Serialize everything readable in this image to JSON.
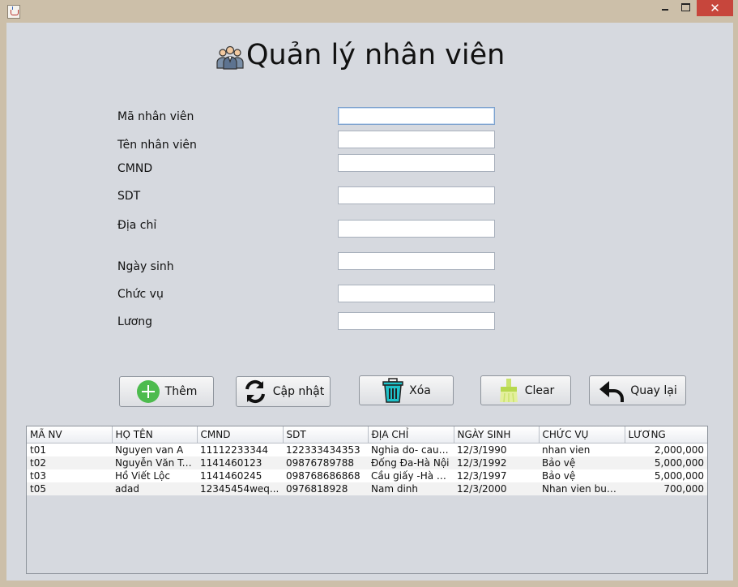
{
  "window": {
    "close_glyph": "✕"
  },
  "header": {
    "title": "Quản lý nhân viên",
    "icon": "people-group-icon"
  },
  "form": {
    "fields": [
      {
        "label": "Mã nhân viên",
        "value": ""
      },
      {
        "label": "Tên nhân viên",
        "value": ""
      },
      {
        "label": "CMND",
        "value": ""
      },
      {
        "label": "SDT",
        "value": ""
      },
      {
        "label": "Địa chỉ",
        "value": ""
      },
      {
        "label": "Ngày sinh",
        "value": ""
      },
      {
        "label": "Chức vụ",
        "value": ""
      },
      {
        "label": "Lương",
        "value": ""
      }
    ]
  },
  "buttons": {
    "add": "Thêm",
    "update": "Cập nhật",
    "delete": "Xóa",
    "clear": "Clear",
    "back": "Quay lại"
  },
  "colors": {
    "add_icon": "#4dbb4e",
    "delete_icon": "#1fc2c9",
    "clear_icon": "#c9e36c"
  },
  "table": {
    "columns": [
      "MÃ NV",
      "HỌ TÊN",
      "CMND",
      "SDT",
      "ĐỊA CHỈ",
      "NGÀY SINH",
      "CHỨC VỤ",
      "LƯƠNG"
    ],
    "rows": [
      [
        "t01",
        "Nguyen van A",
        "11112233344",
        "122333434353",
        "Nghia do- cau g...",
        "12/3/1990",
        "nhan vien",
        "2,000,000"
      ],
      [
        "t02",
        "Nguyễn Văn Tu...",
        "1141460123",
        "09876789788",
        "Đống Đa-Hà Nội",
        "12/3/1992",
        "Bảo vệ",
        "5,000,000"
      ],
      [
        "t03",
        "Hồ Viết Lộc",
        "1141460245",
        "098768686868",
        "Cầu giấy -Hà nội",
        "12/3/1997",
        "Bảo vệ",
        "5,000,000"
      ],
      [
        "t05",
        "adad",
        "12345454weq...",
        "0976818928",
        "Nam dinh",
        "12/3/2000",
        "Nhan vien buong",
        "700,000"
      ]
    ]
  }
}
